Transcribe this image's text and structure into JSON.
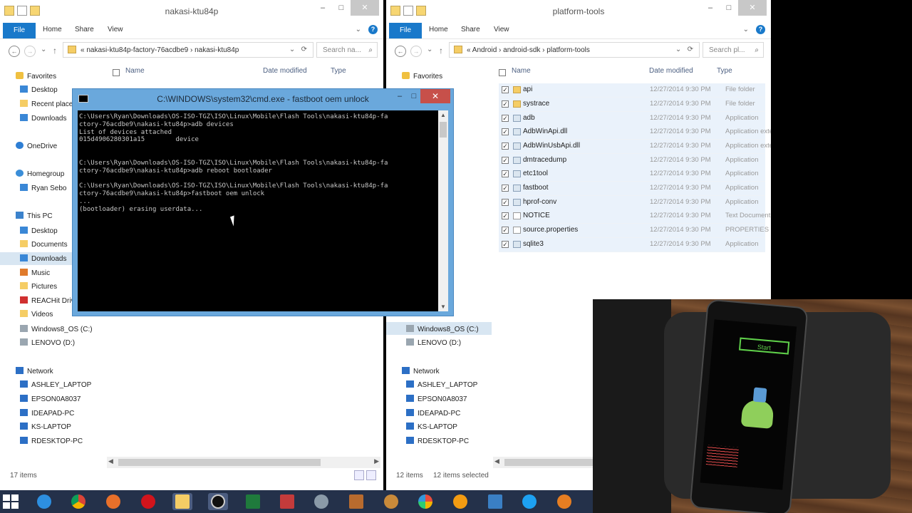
{
  "left_window": {
    "title": "nakasi-ktu84p",
    "ribbon_tabs": [
      "File",
      "Home",
      "Share",
      "View"
    ],
    "address_path": "«  nakasi-ktu84p-factory-76acdbe9  ›  nakasi-ktu84p",
    "search_placeholder": "Search na...",
    "columns": [
      "Name",
      "Date modified",
      "Type"
    ],
    "nav": {
      "favorites": "Favorites",
      "desktop": "Desktop",
      "recent": "Recent places",
      "downloads": "Downloads",
      "onedrive": "OneDrive",
      "homegroup": "Homegroup",
      "homegroup_user": "Ryan Sebo",
      "thispc": "This PC",
      "pc_desktop": "Desktop",
      "documents": "Documents",
      "pc_downloads": "Downloads",
      "music": "Music",
      "pictures": "Pictures",
      "reachit": "REACHit Drive",
      "videos": "Videos",
      "drive_c": "Windows8_OS (C:)",
      "drive_d": "LENOVO (D:)",
      "network": "Network",
      "net1": "ASHLEY_LAPTOP",
      "net2": "EPSON0A8037",
      "net3": "IDEAPAD-PC",
      "net4": "KS-LAPTOP",
      "net5": "RDESKTOP-PC"
    },
    "status_items": "17 items"
  },
  "right_window": {
    "title": "platform-tools",
    "ribbon_tabs": [
      "File",
      "Home",
      "Share",
      "View"
    ],
    "address_path": "«  Android  ›  android-sdk  ›  platform-tools",
    "search_placeholder": "Search pl...",
    "columns": [
      "Name",
      "Date modified",
      "Type"
    ],
    "nav": {
      "favorites": "Favorites",
      "drive_c": "Windows8_OS (C:)",
      "drive_d": "LENOVO (D:)",
      "network": "Network",
      "net1": "ASHLEY_LAPTOP",
      "net2": "EPSON0A8037",
      "net3": "IDEAPAD-PC",
      "net4": "KS-LAPTOP",
      "net5": "RDESKTOP-PC"
    },
    "files": [
      {
        "name": "api",
        "date": "12/27/2014 9:30 PM",
        "type": "File folder",
        "icon": "folder-icon"
      },
      {
        "name": "systrace",
        "date": "12/27/2014 9:30 PM",
        "type": "File folder",
        "icon": "folder-icon"
      },
      {
        "name": "adb",
        "date": "12/27/2014 9:30 PM",
        "type": "Application",
        "icon": "app-icon"
      },
      {
        "name": "AdbWinApi.dll",
        "date": "12/27/2014 9:30 PM",
        "type": "Application exte",
        "icon": "dll-icon"
      },
      {
        "name": "AdbWinUsbApi.dll",
        "date": "12/27/2014 9:30 PM",
        "type": "Application exte",
        "icon": "dll-icon"
      },
      {
        "name": "dmtracedump",
        "date": "12/27/2014 9:30 PM",
        "type": "Application",
        "icon": "app-icon"
      },
      {
        "name": "etc1tool",
        "date": "12/27/2014 9:30 PM",
        "type": "Application",
        "icon": "app-icon"
      },
      {
        "name": "fastboot",
        "date": "12/27/2014 9:30 PM",
        "type": "Application",
        "icon": "app-icon"
      },
      {
        "name": "hprof-conv",
        "date": "12/27/2014 9:30 PM",
        "type": "Application",
        "icon": "app-icon"
      },
      {
        "name": "NOTICE",
        "date": "12/27/2014 9:30 PM",
        "type": "Text Document",
        "icon": "text-file-icon"
      },
      {
        "name": "source.properties",
        "date": "12/27/2014 9:30 PM",
        "type": "PROPERTIES File",
        "icon": "properties-file-icon"
      },
      {
        "name": "sqlite3",
        "date": "12/27/2014 9:30 PM",
        "type": "Application",
        "icon": "app-icon"
      }
    ],
    "status_items": "12 items",
    "status_selected": "12 items selected"
  },
  "cmd": {
    "title": "C:\\WINDOWS\\system32\\cmd.exe - fastboot  oem unlock",
    "output": "C:\\Users\\Ryan\\Downloads\\OS-ISO-TGZ\\ISO\\Linux\\Mobile\\Flash Tools\\nakasi-ktu84p-fa\nctory-76acdbe9\\nakasi-ktu84p>adb devices\nList of devices attached\n015d4906280301a15        device\n\n\nC:\\Users\\Ryan\\Downloads\\OS-ISO-TGZ\\ISO\\Linux\\Mobile\\Flash Tools\\nakasi-ktu84p-fa\nctory-76acdbe9\\nakasi-ktu84p>adb reboot bootloader\n\nC:\\Users\\Ryan\\Downloads\\OS-ISO-TGZ\\ISO\\Linux\\Mobile\\Flash Tools\\nakasi-ktu84p-fa\nctory-76acdbe9\\nakasi-ktu84p>fastboot oem unlock\n...\n(bootloader) erasing userdata..."
  },
  "phone": {
    "start_label": "Start"
  },
  "taskbar": {
    "icons": [
      "windows-start-icon",
      "internet-explorer-icon",
      "chrome-icon",
      "firefox-icon",
      "opera-icon",
      "file-explorer-icon",
      "media-icon",
      "excel-icon",
      "app-icon",
      "settings-icon",
      "tools-icon",
      "paint-icon",
      "color-icon",
      "media-player-icon",
      "network-icon",
      "bird-icon",
      "orange-icon"
    ]
  },
  "colors": {
    "file_tab": "#1979ca",
    "cmd_frame": "#6aa8dc",
    "cmd_close": "#c7504a",
    "taskbar": "#24314a",
    "selection": "#d8e6f2",
    "start_green": "#5fd04a"
  }
}
